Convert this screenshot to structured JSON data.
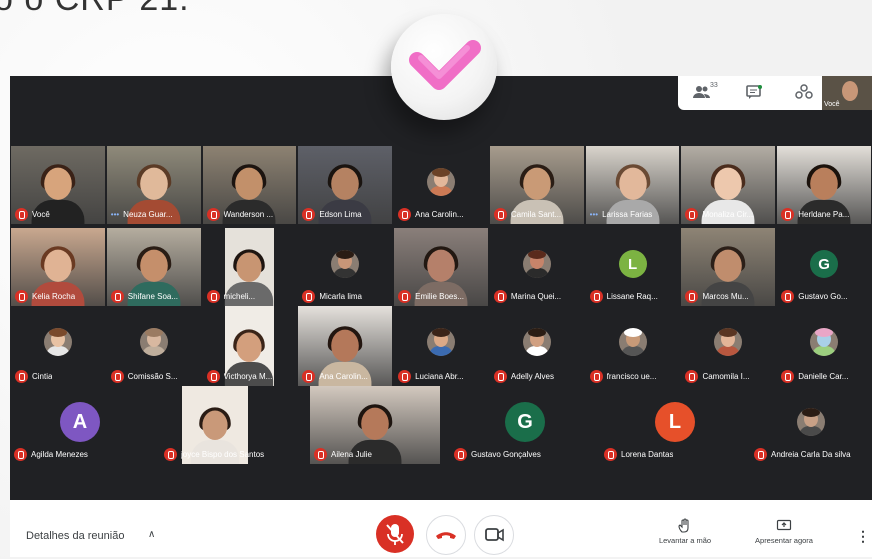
{
  "heading": "o o CRP 21.",
  "toolbar": {
    "people_icon": "people-icon",
    "people_count": "33",
    "chat_icon": "chat-icon",
    "activities_icon": "activities-icon",
    "self_view_label": "Você"
  },
  "participants": [
    {
      "name": "Você",
      "kind": "video",
      "skin": "#d7a47c",
      "hair": "#3a2217",
      "shirt": "#222",
      "bg": "#6e6a62",
      "muted": true
    },
    {
      "name": "Neuza Guar...",
      "kind": "video",
      "skin": "#e0b99a",
      "hair": "#5b3b26",
      "shirt": "#a44b33",
      "bg": "#8f8a7a",
      "muted": false,
      "speaking": true
    },
    {
      "name": "Wanderson ...",
      "kind": "video",
      "skin": "#c2906a",
      "hair": "#1c1410",
      "shirt": "#2b2b2b",
      "bg": "#8d8272",
      "muted": true
    },
    {
      "name": "Edson Lima",
      "kind": "video",
      "skin": "#b58262",
      "hair": "#1a1410",
      "shirt": "#3b3b44",
      "bg": "#5e6068",
      "muted": true
    },
    {
      "name": "Ana Carolin...",
      "kind": "photo",
      "skin": "#e2b79a",
      "hair": "#6b4227",
      "shirt": "#cc7a55",
      "muted": true
    },
    {
      "name": "Camila Sant...",
      "kind": "video",
      "skin": "#c99a76",
      "hair": "#2a1d15",
      "shirt": "#c9c1b5",
      "bg": "#a79c8d",
      "muted": true
    },
    {
      "name": "Larissa Farias",
      "kind": "video",
      "skin": "#e2b89b",
      "hair": "#6a4a34",
      "shirt": "#a9a9a9",
      "bg": "#d9d4cc",
      "muted": false,
      "speaking": true
    },
    {
      "name": "Monaliza Cir...",
      "kind": "video",
      "skin": "#edc8ad",
      "hair": "#4a2c1d",
      "shirt": "#e8e8e8",
      "bg": "#b3ada4",
      "muted": true
    },
    {
      "name": "Herldane Pa...",
      "kind": "video",
      "skin": "#b97f5c",
      "hair": "#1b120c",
      "shirt": "#2b2b2b",
      "bg": "#e3dfd9",
      "muted": true
    },
    {
      "name": "Kelia Rocha",
      "kind": "video",
      "skin": "#e0b394",
      "hair": "#6a3a22",
      "shirt": "#b14b3d",
      "bg": "#c9a88f",
      "muted": true
    },
    {
      "name": "Shifane Soa...",
      "kind": "video",
      "skin": "#c58f6b",
      "hair": "#2a1d15",
      "shirt": "#2f6b5e",
      "bg": "#b5ad9f",
      "muted": true
    },
    {
      "name": "micheli...",
      "kind": "video-narrow",
      "skin": "#c89572",
      "hair": "#1e1510",
      "shirt": "#6a6a6a",
      "bg": "#e5e1da",
      "muted": true
    },
    {
      "name": "Micarla lima",
      "kind": "photo",
      "skin": "#c89678",
      "hair": "#2a1c14",
      "shirt": "#333",
      "muted": true
    },
    {
      "name": "Emilie Boes...",
      "kind": "video",
      "skin": "#b5806a",
      "hair": "#221812",
      "shirt": "#7d6c64",
      "bg": "#8a7f7a",
      "muted": true
    },
    {
      "name": "Marina Quei...",
      "kind": "photo",
      "skin": "#c7846a",
      "hair": "#5a2b1c",
      "shirt": "#2b2b2b",
      "muted": true
    },
    {
      "name": "Lissane Raq...",
      "kind": "letter",
      "letter": "L",
      "color": "#7cb342",
      "muted": true
    },
    {
      "name": "Marcos Mu...",
      "kind": "video",
      "skin": "#c08d6d",
      "hair": "#2b1f18",
      "shirt": "#444",
      "bg": "#8e8475",
      "muted": true
    },
    {
      "name": "Gustavo Go...",
      "kind": "letter",
      "letter": "G",
      "color": "#1a6e4a",
      "muted": true
    },
    {
      "name": "Cintia",
      "kind": "photo",
      "skin": "#e8c2a4",
      "hair": "#7a4a2c",
      "shirt": "#e6e6e6",
      "muted": true
    },
    {
      "name": "Comissão S...",
      "kind": "photo",
      "skin": "#d8b8a0",
      "hair": "#9a7b62",
      "shirt": "#bfae9c",
      "muted": true
    },
    {
      "name": "Victhorya M...",
      "kind": "video-narrow",
      "skin": "#d39f7d",
      "hair": "#3a2418",
      "shirt": "#4c4c4c",
      "bg": "#f0ece6",
      "muted": true
    },
    {
      "name": "Ana Carolin...",
      "kind": "video",
      "skin": "#b4785a",
      "hair": "#231610",
      "shirt": "#c9b7a0",
      "bg": "#e5e1dc",
      "muted": true
    },
    {
      "name": "Luciana Abr...",
      "kind": "photo",
      "skin": "#dba987",
      "hair": "#3b2418",
      "shirt": "#3b6bb1",
      "muted": true
    },
    {
      "name": "Adelly Alves",
      "kind": "photo",
      "skin": "#d1a081",
      "hair": "#2b1d14",
      "shirt": "#ffffff",
      "muted": true
    },
    {
      "name": "francisco ue...",
      "kind": "photo",
      "skin": "#c89a78",
      "hair": "#ffffff",
      "shirt": "#555",
      "muted": true
    },
    {
      "name": "Camomila I...",
      "kind": "photo",
      "skin": "#e3b598",
      "hair": "#5a3522",
      "shirt": "#b8573f",
      "muted": true
    },
    {
      "name": "Danielle Car...",
      "kind": "photo",
      "skin": "#a9d0e8",
      "hair": "#e9a6c7",
      "shirt": "#9ccf7f",
      "muted": true
    },
    {
      "name": "Agilda Menezes",
      "kind": "letter",
      "letter": "A",
      "color": "#7e57c2",
      "muted": true
    },
    {
      "name": "joyce Bispo dos Santos",
      "kind": "video-narrow",
      "skin": "#c99979",
      "hair": "#2a1c14",
      "shirt": "#e9e4de",
      "bg": "#efe9e1",
      "muted": true
    },
    {
      "name": "Ailena Julie",
      "kind": "video",
      "skin": "#b5795a",
      "hair": "#1e1510",
      "shirt": "#2b2b2b",
      "bg": "#d3c9bf",
      "muted": true
    },
    {
      "name": "Gustavo Gonçalves",
      "kind": "letter",
      "letter": "G",
      "color": "#1a6e4a",
      "muted": true
    },
    {
      "name": "Lorena Dantas",
      "kind": "letter",
      "letter": "L",
      "color": "#e6502a",
      "muted": true
    },
    {
      "name": "Andreia Carla Da silva",
      "kind": "photo",
      "skin": "#c8a086",
      "hair": "#2b1c14",
      "shirt": "#4a4a4a",
      "muted": true
    }
  ],
  "bottom": {
    "details_label": "Detalhes da reunião",
    "raise_hand_label": "Levantar a mão",
    "present_label": "Apresentar agora"
  },
  "overlay": {
    "check_color": "#f06ec6"
  }
}
